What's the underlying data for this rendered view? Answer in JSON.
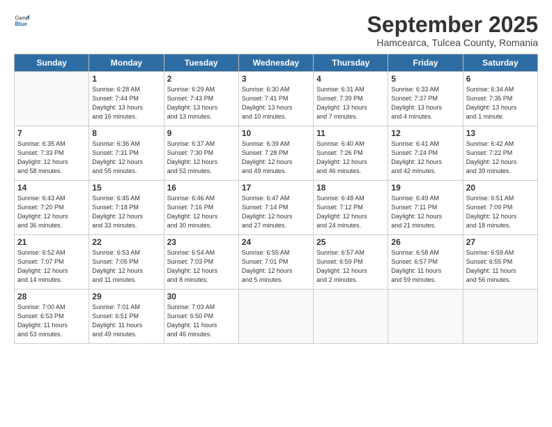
{
  "logo": {
    "general": "General",
    "blue": "Blue"
  },
  "title": "September 2025",
  "location": "Hamcearca, Tulcea County, Romania",
  "days_of_week": [
    "Sunday",
    "Monday",
    "Tuesday",
    "Wednesday",
    "Thursday",
    "Friday",
    "Saturday"
  ],
  "weeks": [
    [
      {
        "day": "",
        "info": ""
      },
      {
        "day": "1",
        "info": "Sunrise: 6:28 AM\nSunset: 7:44 PM\nDaylight: 13 hours\nand 16 minutes."
      },
      {
        "day": "2",
        "info": "Sunrise: 6:29 AM\nSunset: 7:43 PM\nDaylight: 13 hours\nand 13 minutes."
      },
      {
        "day": "3",
        "info": "Sunrise: 6:30 AM\nSunset: 7:41 PM\nDaylight: 13 hours\nand 10 minutes."
      },
      {
        "day": "4",
        "info": "Sunrise: 6:31 AM\nSunset: 7:39 PM\nDaylight: 13 hours\nand 7 minutes."
      },
      {
        "day": "5",
        "info": "Sunrise: 6:33 AM\nSunset: 7:37 PM\nDaylight: 13 hours\nand 4 minutes."
      },
      {
        "day": "6",
        "info": "Sunrise: 6:34 AM\nSunset: 7:35 PM\nDaylight: 13 hours\nand 1 minute."
      }
    ],
    [
      {
        "day": "7",
        "info": "Sunrise: 6:35 AM\nSunset: 7:33 PM\nDaylight: 12 hours\nand 58 minutes."
      },
      {
        "day": "8",
        "info": "Sunrise: 6:36 AM\nSunset: 7:31 PM\nDaylight: 12 hours\nand 55 minutes."
      },
      {
        "day": "9",
        "info": "Sunrise: 6:37 AM\nSunset: 7:30 PM\nDaylight: 12 hours\nand 52 minutes."
      },
      {
        "day": "10",
        "info": "Sunrise: 6:39 AM\nSunset: 7:28 PM\nDaylight: 12 hours\nand 49 minutes."
      },
      {
        "day": "11",
        "info": "Sunrise: 6:40 AM\nSunset: 7:26 PM\nDaylight: 12 hours\nand 46 minutes."
      },
      {
        "day": "12",
        "info": "Sunrise: 6:41 AM\nSunset: 7:24 PM\nDaylight: 12 hours\nand 42 minutes."
      },
      {
        "day": "13",
        "info": "Sunrise: 6:42 AM\nSunset: 7:22 PM\nDaylight: 12 hours\nand 39 minutes."
      }
    ],
    [
      {
        "day": "14",
        "info": "Sunrise: 6:43 AM\nSunset: 7:20 PM\nDaylight: 12 hours\nand 36 minutes."
      },
      {
        "day": "15",
        "info": "Sunrise: 6:45 AM\nSunset: 7:18 PM\nDaylight: 12 hours\nand 33 minutes."
      },
      {
        "day": "16",
        "info": "Sunrise: 6:46 AM\nSunset: 7:16 PM\nDaylight: 12 hours\nand 30 minutes."
      },
      {
        "day": "17",
        "info": "Sunrise: 6:47 AM\nSunset: 7:14 PM\nDaylight: 12 hours\nand 27 minutes."
      },
      {
        "day": "18",
        "info": "Sunrise: 6:48 AM\nSunset: 7:12 PM\nDaylight: 12 hours\nand 24 minutes."
      },
      {
        "day": "19",
        "info": "Sunrise: 6:49 AM\nSunset: 7:11 PM\nDaylight: 12 hours\nand 21 minutes."
      },
      {
        "day": "20",
        "info": "Sunrise: 6:51 AM\nSunset: 7:09 PM\nDaylight: 12 hours\nand 18 minutes."
      }
    ],
    [
      {
        "day": "21",
        "info": "Sunrise: 6:52 AM\nSunset: 7:07 PM\nDaylight: 12 hours\nand 14 minutes."
      },
      {
        "day": "22",
        "info": "Sunrise: 6:53 AM\nSunset: 7:05 PM\nDaylight: 12 hours\nand 11 minutes."
      },
      {
        "day": "23",
        "info": "Sunrise: 6:54 AM\nSunset: 7:03 PM\nDaylight: 12 hours\nand 8 minutes."
      },
      {
        "day": "24",
        "info": "Sunrise: 6:55 AM\nSunset: 7:01 PM\nDaylight: 12 hours\nand 5 minutes."
      },
      {
        "day": "25",
        "info": "Sunrise: 6:57 AM\nSunset: 6:59 PM\nDaylight: 12 hours\nand 2 minutes."
      },
      {
        "day": "26",
        "info": "Sunrise: 6:58 AM\nSunset: 6:57 PM\nDaylight: 11 hours\nand 59 minutes."
      },
      {
        "day": "27",
        "info": "Sunrise: 6:59 AM\nSunset: 6:55 PM\nDaylight: 11 hours\nand 56 minutes."
      }
    ],
    [
      {
        "day": "28",
        "info": "Sunrise: 7:00 AM\nSunset: 6:53 PM\nDaylight: 11 hours\nand 53 minutes."
      },
      {
        "day": "29",
        "info": "Sunrise: 7:01 AM\nSunset: 6:51 PM\nDaylight: 11 hours\nand 49 minutes."
      },
      {
        "day": "30",
        "info": "Sunrise: 7:03 AM\nSunset: 6:50 PM\nDaylight: 11 hours\nand 46 minutes."
      },
      {
        "day": "",
        "info": ""
      },
      {
        "day": "",
        "info": ""
      },
      {
        "day": "",
        "info": ""
      },
      {
        "day": "",
        "info": ""
      }
    ]
  ]
}
